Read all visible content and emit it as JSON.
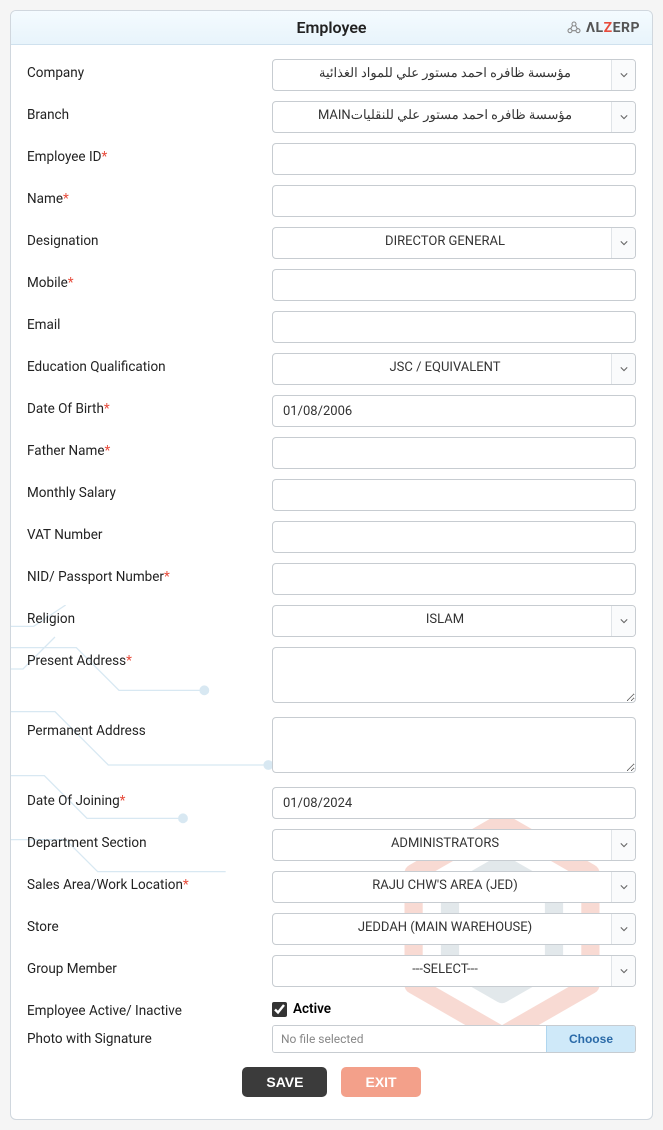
{
  "header": {
    "title": "Employee",
    "logo_text_1": "ΛL",
    "logo_text_2": "Z",
    "logo_text_3": "ERP"
  },
  "fields": {
    "company": {
      "label": "Company",
      "value": "مؤسسة ظافره احمد مستور علي للمواد الغذائية",
      "required": false
    },
    "branch": {
      "label": "Branch",
      "value": "MAINمؤسسة ظافره احمد مستور علي للنقليات",
      "required": false
    },
    "emp_id": {
      "label": "Employee ID",
      "value": "",
      "required": true
    },
    "name": {
      "label": "Name",
      "value": "",
      "required": true
    },
    "designation": {
      "label": "Designation",
      "value": "DIRECTOR GENERAL",
      "required": false
    },
    "mobile": {
      "label": "Mobile",
      "value": "",
      "required": true
    },
    "email": {
      "label": "Email",
      "value": "",
      "required": false
    },
    "education": {
      "label": "Education Qualification",
      "value": "JSC / EQUIVALENT",
      "required": false
    },
    "dob": {
      "label": "Date Of Birth",
      "value": "01/08/2006",
      "required": true
    },
    "father": {
      "label": "Father Name",
      "value": "",
      "required": true
    },
    "salary": {
      "label": "Monthly Salary",
      "value": "",
      "required": false
    },
    "vat": {
      "label": "VAT Number",
      "value": "",
      "required": false
    },
    "nid": {
      "label": "NID/ Passport Number",
      "value": "",
      "required": true
    },
    "religion": {
      "label": "Religion",
      "value": "ISLAM",
      "required": false
    },
    "present_addr": {
      "label": "Present Address",
      "value": "",
      "required": true
    },
    "permanent_addr": {
      "label": "Permanent Address",
      "value": "",
      "required": false
    },
    "doj": {
      "label": "Date Of Joining",
      "value": "01/08/2024",
      "required": true
    },
    "dept": {
      "label": "Department Section",
      "value": "ADMINISTRATORS",
      "required": false
    },
    "sales_area": {
      "label": "Sales Area/Work Location",
      "value": "RAJU CHW'S AREA (JED)",
      "required": true
    },
    "store": {
      "label": "Store",
      "value": "JEDDAH (MAIN WAREHOUSE)",
      "required": false
    },
    "group": {
      "label": "Group Member",
      "value": "---SELECT---",
      "required": false
    },
    "active": {
      "label": "Employee Active/ Inactive",
      "check_label": "Active",
      "checked": true
    },
    "photo": {
      "label": "Photo with Signature",
      "placeholder": "No file selected",
      "choose": "Choose"
    }
  },
  "buttons": {
    "save": "SAVE",
    "exit": "EXIT"
  }
}
